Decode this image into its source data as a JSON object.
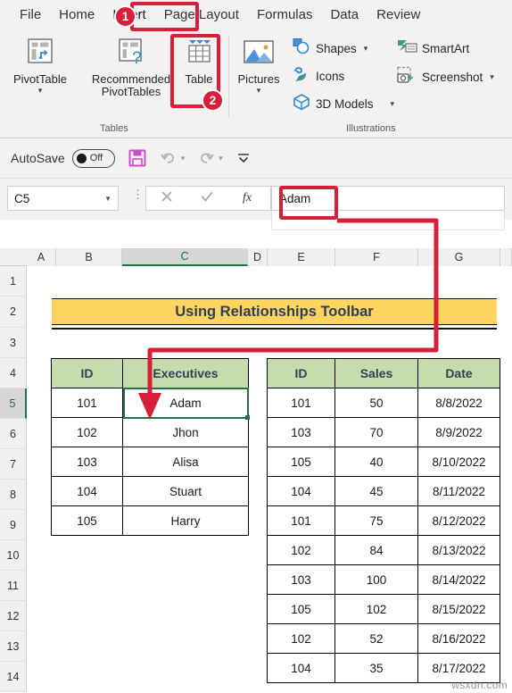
{
  "ribbon": {
    "tabs": [
      {
        "label": "File",
        "active": false
      },
      {
        "label": "Home",
        "active": false
      },
      {
        "label": "Insert",
        "active": true
      },
      {
        "label": "Page Layout",
        "active": false
      },
      {
        "label": "Formulas",
        "active": false
      },
      {
        "label": "Data",
        "active": false
      },
      {
        "label": "Review",
        "active": false
      }
    ],
    "groups": [
      {
        "caption": "Tables"
      },
      {
        "caption": "Illustrations"
      }
    ],
    "buttons": {
      "pivottable": "PivotTable",
      "recommended_line1": "Recommended",
      "recommended_line2": "PivotTables",
      "table": "Table",
      "pictures": "Pictures",
      "shapes": "Shapes",
      "icons": "Icons",
      "models3d": "3D Models",
      "smartart": "SmartArt",
      "screenshot": "Screenshot"
    }
  },
  "quick_access": {
    "autosave_label": "AutoSave",
    "autosave_state": "Off",
    "icons": [
      "save-icon",
      "undo-icon",
      "redo-icon",
      "customize-icon"
    ]
  },
  "formula_bar": {
    "name_box_value": "C5",
    "cancel_icon": "cancel-icon",
    "enter_icon": "enter-icon",
    "function_icon": "insert-function-icon",
    "content": "Adam"
  },
  "sheet": {
    "columns": [
      "A",
      "B",
      "C",
      "D",
      "E",
      "F",
      "G"
    ],
    "selected_column": "C",
    "rows": [
      "1",
      "2",
      "3",
      "4",
      "5",
      "6",
      "7",
      "8",
      "9",
      "10",
      "11",
      "12",
      "13",
      "14"
    ],
    "selected_row": "5",
    "title_banner": "Using Relationships Toolbar",
    "selected_cell": "C5",
    "left_table": {
      "headers": [
        "ID",
        "Executives"
      ],
      "rows": [
        [
          "101",
          "Adam"
        ],
        [
          "102",
          "Jhon"
        ],
        [
          "103",
          "Alisa"
        ],
        [
          "104",
          "Stuart"
        ],
        [
          "105",
          "Harry"
        ]
      ]
    },
    "right_table": {
      "headers": [
        "ID",
        "Sales",
        "Date"
      ],
      "rows": [
        [
          "101",
          "50",
          "8/8/2022"
        ],
        [
          "103",
          "70",
          "8/9/2022"
        ],
        [
          "105",
          "40",
          "8/10/2022"
        ],
        [
          "104",
          "45",
          "8/11/2022"
        ],
        [
          "101",
          "75",
          "8/12/2022"
        ],
        [
          "102",
          "84",
          "8/13/2022"
        ],
        [
          "103",
          "100",
          "8/14/2022"
        ],
        [
          "105",
          "102",
          "8/15/2022"
        ],
        [
          "102",
          "52",
          "8/16/2022"
        ],
        [
          "104",
          "35",
          "8/17/2022"
        ]
      ]
    }
  },
  "annotations": {
    "badge_1": "1",
    "badge_2": "2",
    "accent_color": "#d91e3a"
  },
  "watermark": "wsxdn.com"
}
